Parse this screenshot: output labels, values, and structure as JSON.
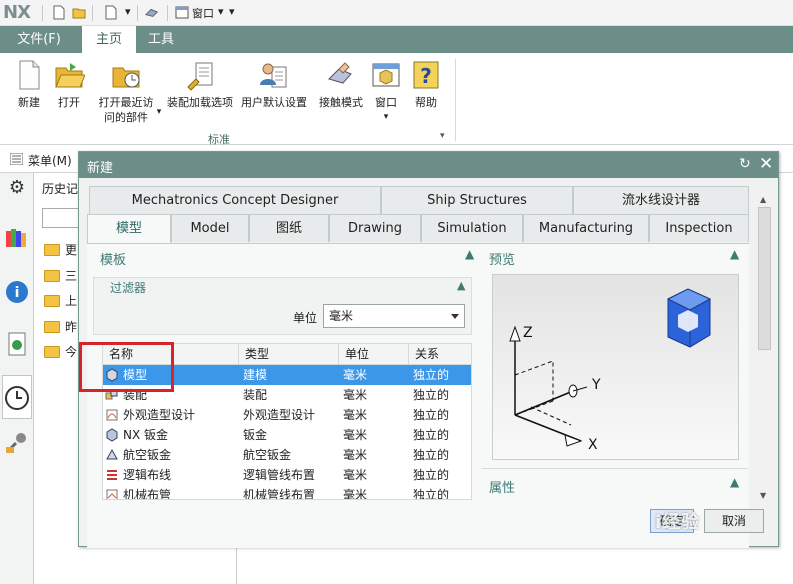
{
  "app": {
    "logo": "NX"
  },
  "quick_access": {
    "window_label": "窗口"
  },
  "ribbon": {
    "tabs": [
      "文件(F)",
      "主页",
      "工具"
    ],
    "buttons": {
      "new": "新建",
      "open": "打开",
      "recent_line1": "打开最近访",
      "recent_line2": "问的部件",
      "assembly_load": "装配加载选项",
      "user_defaults": "用户默认设置",
      "touch_mode": "接触模式",
      "window": "窗口",
      "help": "帮助"
    },
    "group_label": "标准"
  },
  "menu_strip": {
    "menu_label": "菜单(M)"
  },
  "history": {
    "title": "历史记",
    "items": [
      "更",
      "三",
      "上",
      "昨",
      "今"
    ]
  },
  "dialog": {
    "title": "新建",
    "tabs_row1": [
      "Mechatronics Concept Designer",
      "Ship Structures",
      "流水线设计器"
    ],
    "tabs_row2": [
      "模型",
      "Model",
      "图纸",
      "Drawing",
      "Simulation",
      "Manufacturing",
      "Inspection"
    ],
    "templates_header": "模板",
    "filter_header": "过滤器",
    "unit_label": "单位",
    "unit_value": "毫米",
    "table_headers": [
      "名称",
      "类型",
      "单位",
      "关系"
    ],
    "rows": [
      {
        "name": "模型",
        "type": "建模",
        "unit": "毫米",
        "relation": "独立的",
        "selected": true
      },
      {
        "name": "装配",
        "type": "装配",
        "unit": "毫米",
        "relation": "独立的",
        "selected": false
      },
      {
        "name": "外观造型设计",
        "type": "外观造型设计",
        "unit": "毫米",
        "relation": "独立的",
        "selected": false
      },
      {
        "name": "NX 钣金",
        "type": "钣金",
        "unit": "毫米",
        "relation": "独立的",
        "selected": false
      },
      {
        "name": "航空钣金",
        "type": "航空钣金",
        "unit": "毫米",
        "relation": "独立的",
        "selected": false
      },
      {
        "name": "逻辑布线",
        "type": "逻辑管线布置",
        "unit": "毫米",
        "relation": "独立的",
        "selected": false
      },
      {
        "name": "机械布管",
        "type": "机械管线布置",
        "unit": "毫米",
        "relation": "独立的",
        "selected": false
      }
    ],
    "preview_header": "预览",
    "properties_header": "属性",
    "axis_labels": {
      "z": "Z",
      "y": "Y",
      "x": "X"
    },
    "buttons": {
      "ok": "确定",
      "cancel": "取消"
    }
  },
  "watermark": "i经验",
  "colors": {
    "ribbon_tab_bg": "#6c8e88",
    "selected_row": "#3d97e8",
    "highlight_box": "#d8232a",
    "section_header": "#3d7a72"
  }
}
